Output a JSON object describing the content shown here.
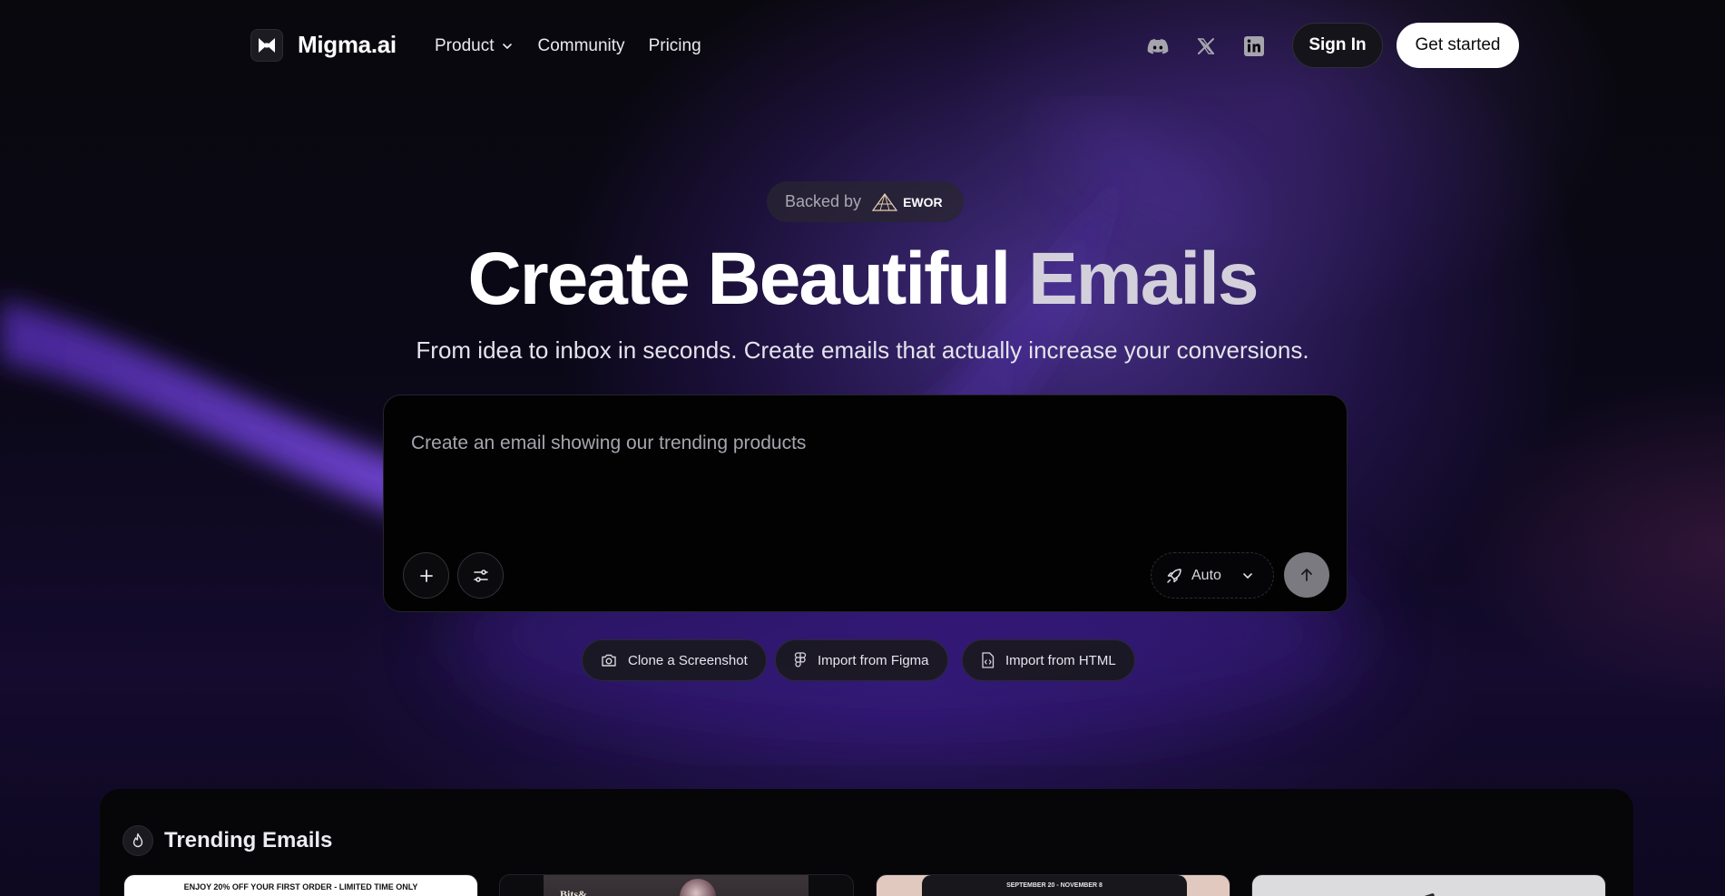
{
  "brand": {
    "name": "Migma.ai",
    "logo_icon": "bowtie-logo-icon"
  },
  "nav": {
    "items": [
      {
        "label": "Product",
        "has_dropdown": true
      },
      {
        "label": "Community",
        "has_dropdown": false
      },
      {
        "label": "Pricing",
        "has_dropdown": false
      }
    ],
    "social_icons": [
      "discord-icon",
      "x-icon",
      "linkedin-icon"
    ],
    "sign_in_label": "Sign In",
    "get_started_label": "Get started"
  },
  "hero": {
    "backed_by_label": "Backed by",
    "backer_name": "EWOR",
    "headline_part1": "Create Beautiful",
    "headline_part2": "Emails",
    "subheadline": "From idea to inbox in seconds. Create emails that actually increase your conversions."
  },
  "prompt": {
    "placeholder": "Create an email showing our trending products",
    "value": "",
    "mode_label": "Auto",
    "add_icon": "plus-icon",
    "settings_icon": "sliders-icon",
    "mode_icon": "rocket-icon",
    "send_icon": "arrow-up-icon"
  },
  "actions": [
    {
      "label": "Clone a Screenshot",
      "icon": "camera-icon"
    },
    {
      "label": "Import from Figma",
      "icon": "figma-icon"
    },
    {
      "label": "Import from HTML",
      "icon": "html-file-icon"
    }
  ],
  "trending": {
    "title": "Trending Emails",
    "icon": "flame-icon",
    "cards": [
      {
        "text": "ENJOY 20% OFF YOUR FIRST ORDER - LIMITED TIME ONLY"
      },
      {
        "text": "Bits&"
      },
      {
        "text": "SEPTEMBER 20 - NOVEMBER 8"
      },
      {
        "text": ""
      }
    ]
  },
  "colors": {
    "accent_purple": "#7b4fe0",
    "background": "#07060b",
    "button_primary_bg": "#ffffff",
    "send_button": "#7b7a80"
  }
}
